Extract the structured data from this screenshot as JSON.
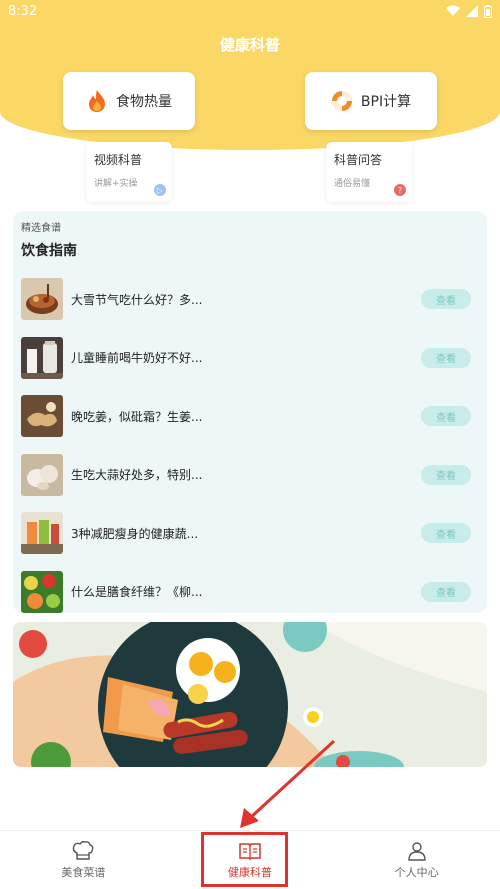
{
  "status_bar": {
    "time": "8:32"
  },
  "app": {
    "title": "健康科普"
  },
  "features": {
    "food_calories": {
      "label": "食物热量",
      "icon": "flame-icon"
    },
    "bpi": {
      "label": "BPI计算",
      "icon": "lifebuoy-icon"
    }
  },
  "mini_cards": {
    "video": {
      "title": "视频科普",
      "subtitle": "讲解+实操",
      "badge": "▷"
    },
    "qa": {
      "title": "科普问答",
      "subtitle": "通俗易懂",
      "badge": "?"
    }
  },
  "guide": {
    "label": "精选食谱",
    "title": "饮食指南",
    "view_label": "查看",
    "items": [
      {
        "title": "大雪节气吃什么好？多..."
      },
      {
        "title": "儿童睡前喝牛奶好不好..."
      },
      {
        "title": "晚吃姜，似砒霜？生姜..."
      },
      {
        "title": "生吃大蒜好处多，特别..."
      },
      {
        "title": "3种减肥瘦身的健康蔬..."
      },
      {
        "title": "什么是膳食纤维？《柳..."
      }
    ]
  },
  "tabs": {
    "recipes": {
      "label": "美食菜谱"
    },
    "health": {
      "label": "健康科普"
    },
    "profile": {
      "label": "个人中心"
    }
  },
  "colors": {
    "header": "#fbd865",
    "accent_red": "#e0322f",
    "guide_bg": "#eef7f7",
    "view_btn": "#c8ecea"
  }
}
